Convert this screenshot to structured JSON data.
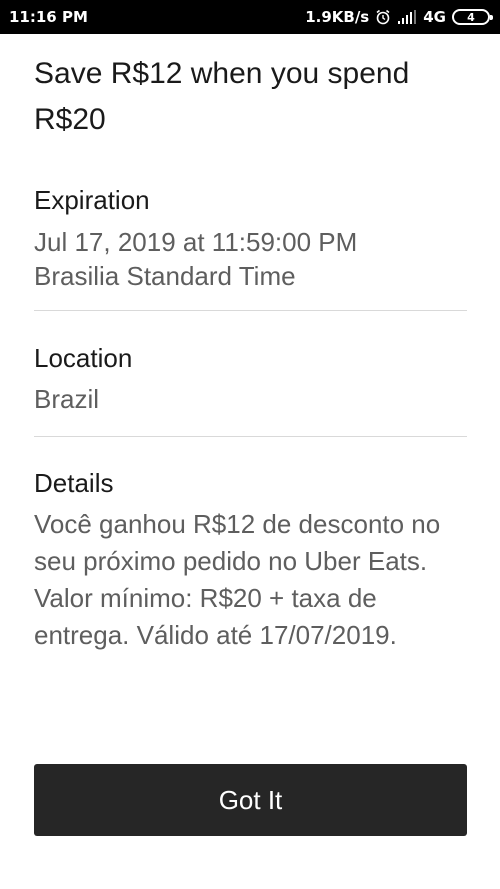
{
  "status_bar": {
    "time": "11:16 PM",
    "network_speed": "1.9KB/s",
    "network_type": "4G",
    "battery_level": "4",
    "icons": [
      "alarm-icon",
      "signal-icon",
      "battery-icon"
    ]
  },
  "promo": {
    "title": "Save R$12 when you spend R$20"
  },
  "sections": {
    "expiration": {
      "heading": "Expiration",
      "date_line": "Jul 17, 2019 at 11:59:00 PM",
      "timezone_line": "Brasilia Standard Time"
    },
    "location": {
      "heading": "Location",
      "value": "Brazil"
    },
    "details": {
      "heading": "Details",
      "text": "Você ganhou R$12 de desconto no seu próximo pedido no Uber Eats. Valor mínimo: R$20 + taxa de entrega. Válido até 17/07/2019."
    }
  },
  "actions": {
    "confirm_label": "Got It"
  },
  "colors": {
    "button_background": "#262626",
    "status_bar_background": "#000000",
    "secondary_text": "#5e5e5e"
  }
}
